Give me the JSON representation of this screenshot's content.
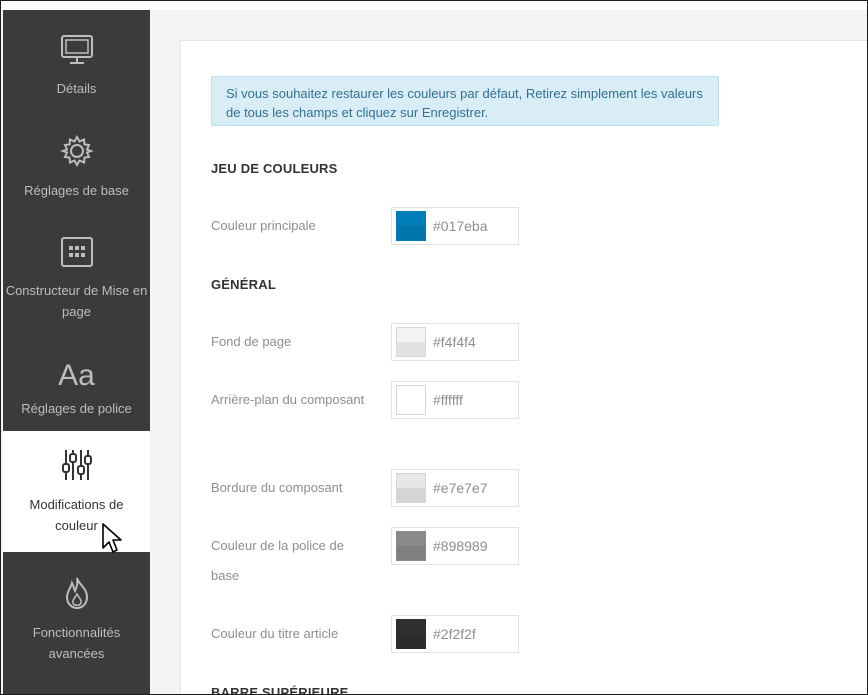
{
  "sidebar": {
    "items": [
      {
        "label": "Détails",
        "icon": "monitor-icon"
      },
      {
        "label": "Réglages de base",
        "icon": "gear-icon"
      },
      {
        "label": "Constructeur de Mise en page",
        "icon": "layout-grid-icon"
      },
      {
        "label": "Réglages de police",
        "icon": "font-icon",
        "glyph": "Aa"
      },
      {
        "label": "Modifications de couleur",
        "icon": "sliders-icon"
      },
      {
        "label": "Fonctionnalités avancées",
        "icon": "flame-icon"
      }
    ],
    "active_index": 4
  },
  "notice": "Si vous souhaitez restaurer les couleurs par défaut, Retirez simplement les valeurs de tous les champs et cliquez sur Enregistrer.",
  "sections": {
    "scheme": "JEU DE COULEURS",
    "general": "GÉNÉRAL",
    "topbar": "BARRE SUPÉRIEURE"
  },
  "fields": {
    "primary": {
      "label": "Couleur principale",
      "value": "#017eba",
      "color": "#017eba"
    },
    "page_bg": {
      "label": "Fond de page",
      "value": "#f4f4f4",
      "color": "#f4f4f4"
    },
    "comp_bg": {
      "label": "Arrière-plan du composant",
      "value": "#ffffff",
      "color": "#ffffff"
    },
    "comp_border": {
      "label": "Bordure du composant",
      "value": "#e7e7e7",
      "color": "#e7e7e7"
    },
    "base_font": {
      "label": "Couleur de la police de base",
      "value": "#898989",
      "color": "#898989"
    },
    "title_color": {
      "label": "Couleur du titre article",
      "value": "#2f2f2f",
      "color": "#2f2f2f"
    }
  },
  "colors": {
    "sidebar_bg": "#3b3b3b",
    "notice_bg": "#d9edf7",
    "notice_text": "#31708f"
  }
}
